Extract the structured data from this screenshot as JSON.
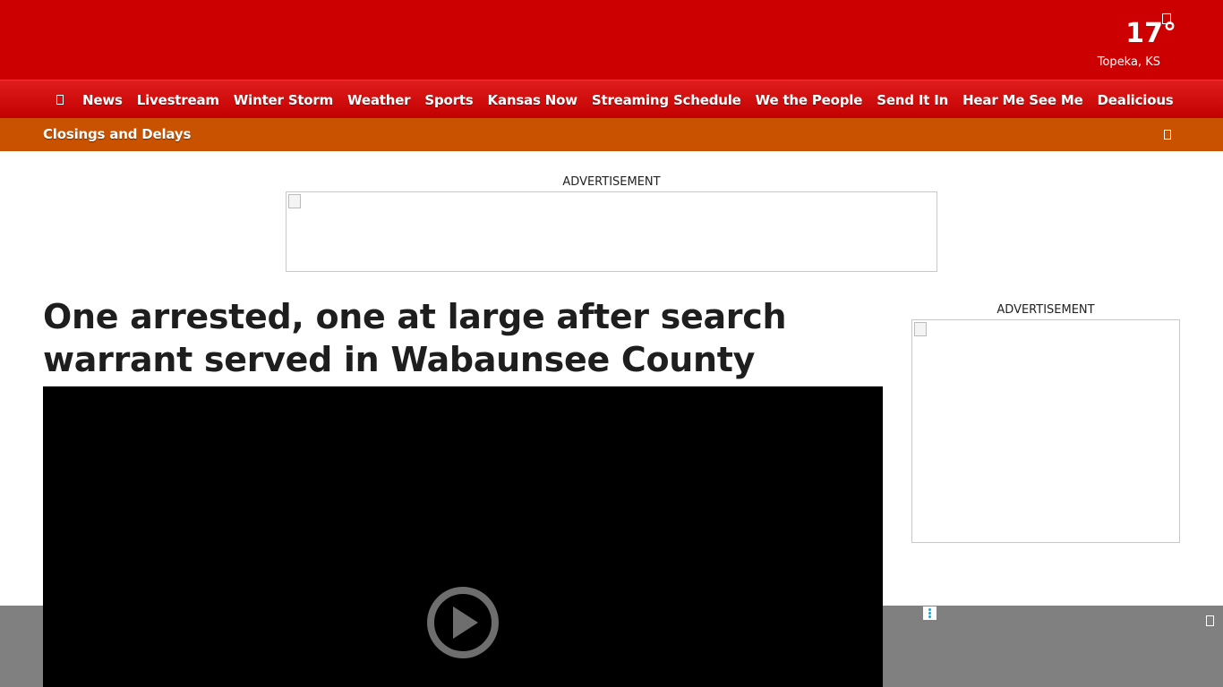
{
  "weather": {
    "temperature": "17°",
    "location": "Topeka, KS"
  },
  "nav": {
    "items": [
      "News",
      "Livestream",
      "Winter Storm",
      "Weather",
      "Sports",
      "Kansas Now",
      "Streaming Schedule",
      "We the People",
      "Send It In",
      "Hear Me See Me",
      "Dealicious"
    ]
  },
  "alert": {
    "label": "Closings and Delays"
  },
  "ads": {
    "top_label": "ADVERTISEMENT",
    "side_label": "ADVERTISEMENT"
  },
  "article": {
    "headline": "One arrested, one at large after search warrant served in Wabaunsee County"
  },
  "colors": {
    "brand_red": "#cc0000",
    "alert_orange": "#c85200",
    "overlay_gray": "#808080"
  }
}
